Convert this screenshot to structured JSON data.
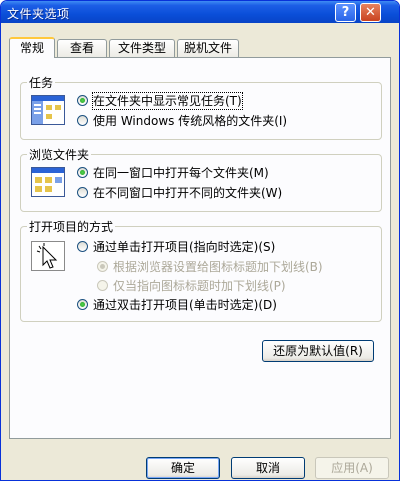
{
  "window": {
    "title": "文件夹选项",
    "help_glyph": "?",
    "close_glyph": "✕"
  },
  "tabs": [
    {
      "label": "常规",
      "active": true
    },
    {
      "label": "查看",
      "active": false
    },
    {
      "label": "文件类型",
      "active": false
    },
    {
      "label": "脱机文件",
      "active": false
    }
  ],
  "groups": {
    "tasks": {
      "legend": "任务",
      "icon": "task-pane-icon",
      "options": [
        {
          "label": "在文件夹中显示常见任务(T)",
          "checked": true
        },
        {
          "label": "使用 Windows 传统风格的文件夹(I)",
          "checked": false
        }
      ]
    },
    "browse": {
      "legend": "浏览文件夹",
      "icon": "browse-window-icon",
      "options": [
        {
          "label": "在同一窗口中打开每个文件夹(M)",
          "checked": true
        },
        {
          "label": "在不同窗口中打开不同的文件夹(W)",
          "checked": false
        }
      ]
    },
    "click": {
      "legend": "打开项目的方式",
      "icon": "pointer-click-icon",
      "options": [
        {
          "label": "通过单击打开项目(指向时选定)(S)",
          "checked": false
        },
        {
          "label": "根据浏览器设置给图标标题加下划线(B)",
          "checked": true,
          "disabled": true
        },
        {
          "label": "仅当指向图标标题时加下划线(P)",
          "checked": false,
          "disabled": true
        },
        {
          "label": "通过双击打开项目(单击时选定)(D)",
          "checked": true
        }
      ]
    }
  },
  "buttons": {
    "restore": "还原为默认值(R)",
    "ok": "确定",
    "cancel": "取消",
    "apply": "应用(A)"
  },
  "colors": {
    "title_bar": "#0a4fd9",
    "dialog_bg": "#ece9d8",
    "tab_accent": "#ffc83c",
    "radio_dot": "#21a121"
  }
}
